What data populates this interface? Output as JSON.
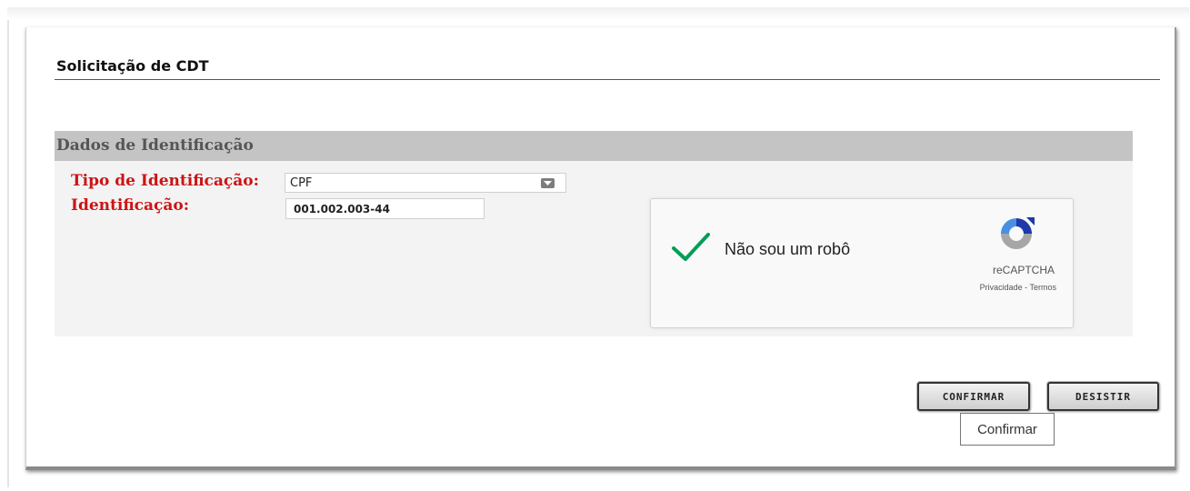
{
  "page": {
    "title": "Solicitação de CDT"
  },
  "section": {
    "title": "Dados de Identificação",
    "fields": {
      "tipo_label": "Tipo de Identificação:",
      "tipo_value": "CPF",
      "identificacao_label": "Identificação:",
      "identificacao_value": "001.002.003-44"
    }
  },
  "captcha": {
    "label": "Não sou um robô",
    "brand": "reCAPTCHA",
    "privacy_link": "Privacidade",
    "separator": " - ",
    "terms_link": "Termos",
    "checked": true,
    "check_color": "#009e55"
  },
  "buttons": {
    "confirm_label": "CONFIRMAR",
    "cancel_label": "DESISTIR"
  },
  "tooltip": {
    "text": "Confirmar"
  },
  "colors": {
    "label_red": "#cc1414",
    "section_header": "#c4c4c4",
    "section_body": "#f3f3f3"
  },
  "icons": {
    "select_arrow": "chevron-down-icon",
    "captcha_check": "checkmark-icon",
    "captcha_logo": "recaptcha-logo-icon"
  }
}
